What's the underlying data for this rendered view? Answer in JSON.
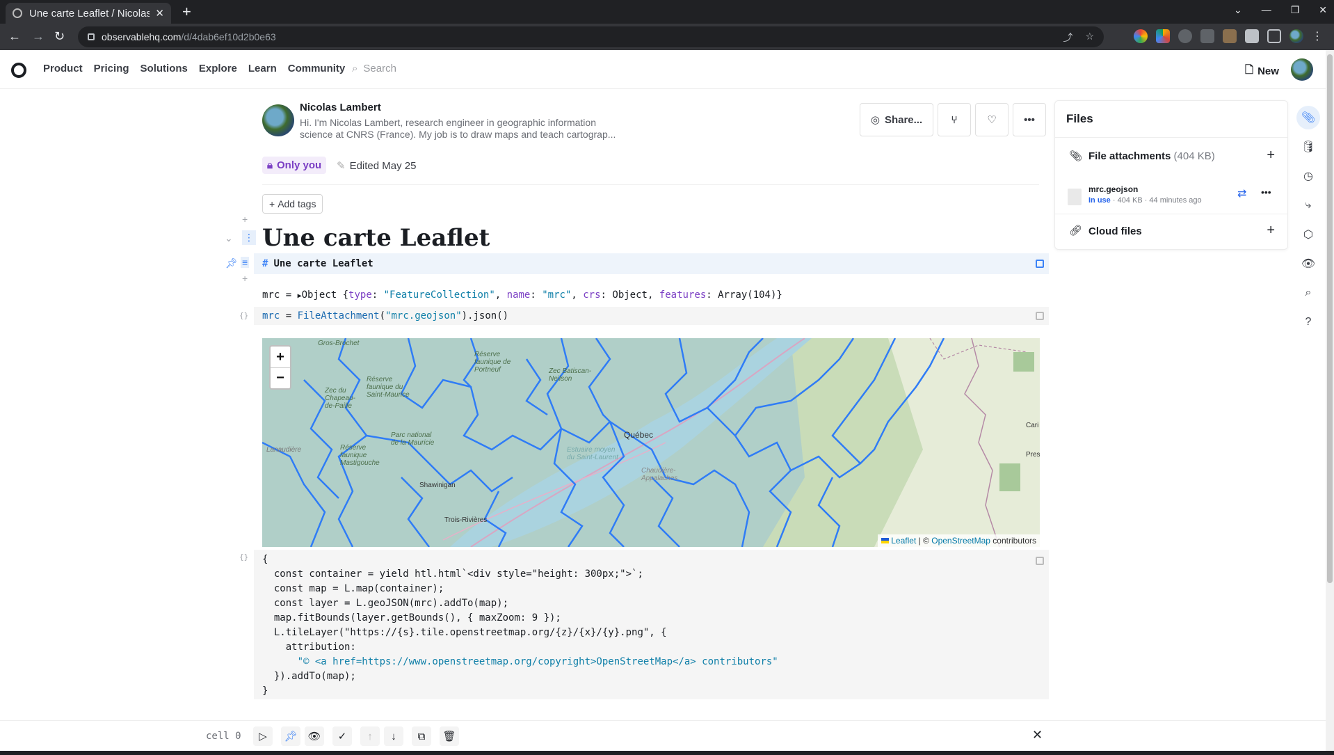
{
  "browser": {
    "tab_title": "Une carte Leaflet / Nicolas Lambert",
    "url_host": "observablehq.com",
    "url_path": "/d/4dab6ef10d2b0e63"
  },
  "header": {
    "nav": [
      "Product",
      "Pricing",
      "Solutions",
      "Explore",
      "Learn",
      "Community"
    ],
    "search_placeholder": "Search",
    "new_label": "New"
  },
  "author": {
    "name": "Nicolas Lambert",
    "bio": "Hi. I'm Nicolas Lambert, research engineer in geographic information science at CNRS (France). My job is to draw maps and teach cartograp..."
  },
  "toolbar": {
    "share_label": "Share..."
  },
  "meta": {
    "visibility": "Only you",
    "edited": "Edited May 25",
    "add_tags": "Add tags"
  },
  "notebook": {
    "title": "Une carte Leaflet",
    "cell0_source": "Une carte Leaflet",
    "cell1_source_fn": "FileAttachment",
    "cell1_source_arg": "\"mrc.geojson\"",
    "cell1_source_rest": ").json()",
    "output_prefix": "mrc = ",
    "output_obj": "Object {",
    "output_type_key": "type",
    "output_type_val": "\"FeatureCollection\"",
    "output_name_key": "name",
    "output_name_val": "\"mrc\"",
    "output_crs_key": "crs",
    "output_crs_val": "Object",
    "output_feat_key": "features",
    "output_feat_val": "Array(104)}",
    "code_lines": [
      "{",
      "  const container = yield htl.html`<div style=\"height: 300px;\">`;",
      "  const map = L.map(container);",
      "  const layer = L.geoJSON(mrc).addTo(map);",
      "  map.fitBounds(layer.getBounds(), { maxZoom: 9 });",
      "  L.tileLayer(\"https://{s}.tile.openstreetmap.org/{z}/{x}/{y}.png\", {",
      "    attribution:",
      "      \"© <a href=https://www.openstreetmap.org/copyright>OpenStreetMap</a> contributors\"",
      "  }).addTo(map);",
      "}"
    ]
  },
  "map": {
    "zoom_in": "+",
    "zoom_out": "−",
    "attr_leaflet": "Leaflet",
    "attr_sep": " | © ",
    "attr_osm": "OpenStreetMap",
    "attr_tail": " contributors",
    "place_labels": [
      "Québec",
      "Shawinigan",
      "Trois-Rivières",
      "Gros-Brochet",
      "Réserve faunique du Saint-Maurice",
      "Zec du Chapeau-de-Paille",
      "Parc national de la Mauricie",
      "Réserve faunique Mastigouche",
      "Réserve faunique de Portneuf",
      "Zec Batiscan-Neilson",
      "Lanaudière",
      "Chaudière-Appalaches",
      "Estuaire moyen du Saint-Laurent",
      "Cari",
      "Pres"
    ]
  },
  "files_panel": {
    "title": "Files",
    "attachments_label": "File attachments",
    "attachments_size": "(404 KB)",
    "file_name": "mrc.geojson",
    "file_status": "In use",
    "file_meta": " · 404 KB · 44 minutes ago",
    "cloud_label": "Cloud files"
  },
  "bottom": {
    "cell_name": "cell 0"
  },
  "colors": {
    "accent": "#3b82f6",
    "private": "#7b3fc4",
    "mrc_line": "#2f7cf6"
  }
}
